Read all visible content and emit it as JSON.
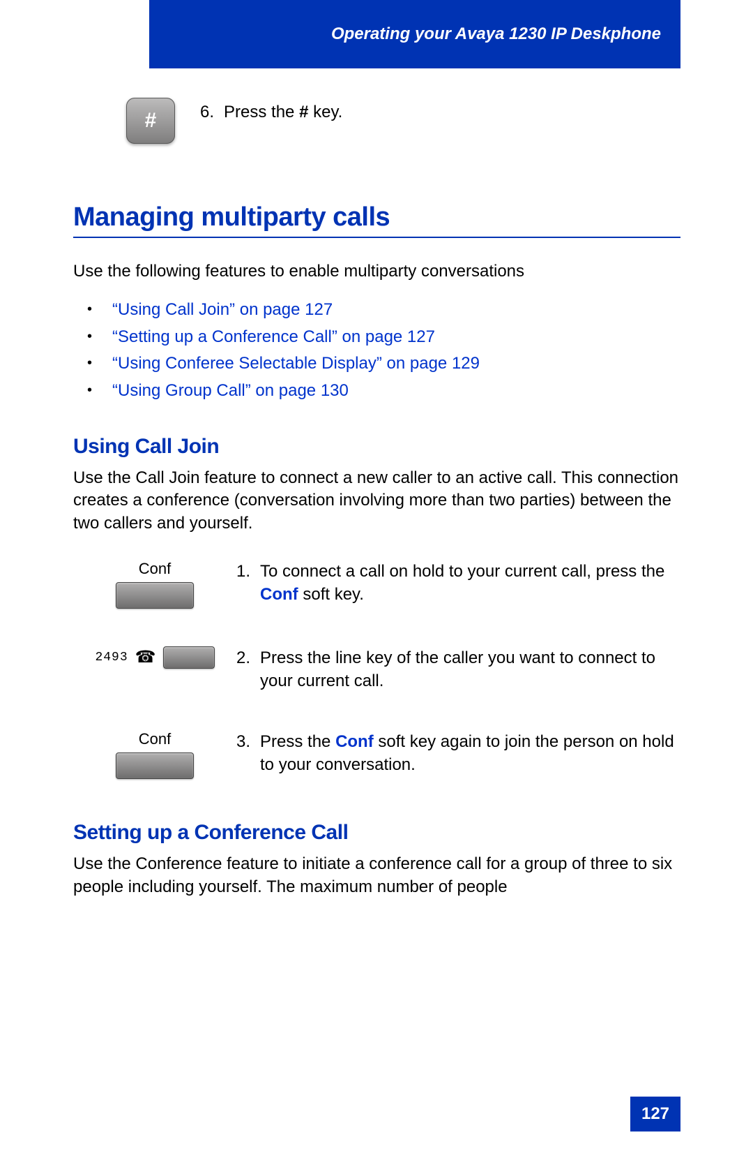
{
  "header": {
    "title": "Operating your Avaya 1230 IP Deskphone"
  },
  "step6": {
    "key_glyph": "#",
    "number": "6.",
    "pre": "Press the ",
    "bold": "#",
    "post": " key."
  },
  "main_heading": "Managing multiparty calls",
  "intro": "Use the following features to enable multiparty conversations",
  "xrefs": [
    "“Using Call Join” on page 127",
    "“Setting up a Conference Call” on page 127",
    "“Using Conferee Selectable Display” on page 129",
    "“Using Group Call” on page 130"
  ],
  "section_cj": {
    "heading": "Using Call Join",
    "body": "Use the Call Join feature to connect a new caller to an active call. This connection creates a conference (conversation involving more than two parties) between the two callers and yourself."
  },
  "steps": {
    "s1": {
      "label": "Conf",
      "num": "1.",
      "pre": "To connect a call on hold to your current call, press the ",
      "bold": "Conf",
      "post": " soft key."
    },
    "s2": {
      "ext": "2493",
      "num": "2.",
      "text": "Press the line key of the caller you want to connect to your current call."
    },
    "s3": {
      "label": "Conf",
      "num": "3.",
      "pre": "Press the ",
      "bold": "Conf",
      "post": " soft key again to join the person on hold to your conversation."
    }
  },
  "section_conf": {
    "heading": "Setting up a Conference Call",
    "body": "Use the Conference feature to initiate a conference call for a group of three to six people including yourself. The maximum number of people"
  },
  "page_number": "127"
}
